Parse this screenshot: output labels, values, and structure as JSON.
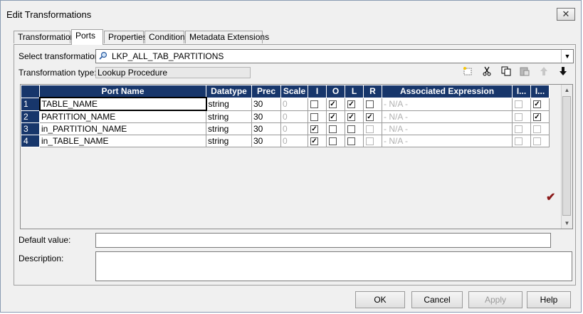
{
  "window": {
    "title": "Edit Transformations",
    "close_glyph": "✕"
  },
  "tabs": [
    {
      "label": "Transformation"
    },
    {
      "label": "Ports"
    },
    {
      "label": "Properties"
    },
    {
      "label": "Condition"
    },
    {
      "label": "Metadata Extensions"
    }
  ],
  "active_tab": "Ports",
  "select_transformation": {
    "label": "Select transformation:",
    "value": "LKP_ALL_TAB_PARTITIONS",
    "icon": "lookup-icon"
  },
  "transformation_type": {
    "label": "Transformation type:",
    "value": "Lookup Procedure"
  },
  "toolbar": {
    "icons": [
      "new-port-icon",
      "cut-icon",
      "copy-icon",
      "paste-icon",
      "move-up-icon",
      "move-down-icon"
    ]
  },
  "ports_table": {
    "columns": [
      "Port Name",
      "Datatype",
      "Prec",
      "Scale",
      "I",
      "O",
      "L",
      "R",
      "Associated Expression",
      "I...",
      "I..."
    ],
    "rows": [
      {
        "num": "1",
        "name": "TABLE_NAME",
        "datatype": "string",
        "prec": "30",
        "scale": "0",
        "I": false,
        "O": true,
        "L": true,
        "R": false,
        "assoc": "- N/A -",
        "c1": false,
        "c2": true
      },
      {
        "num": "2",
        "name": "PARTITION_NAME",
        "datatype": "string",
        "prec": "30",
        "scale": "0",
        "I": false,
        "O": true,
        "L": true,
        "R": true,
        "assoc": "- N/A -",
        "c1": false,
        "c2": true
      },
      {
        "num": "3",
        "name": "in_PARTITION_NAME",
        "datatype": "string",
        "prec": "30",
        "scale": "0",
        "I": true,
        "O": false,
        "L": false,
        "R": false,
        "assoc": "- N/A -",
        "c1": false,
        "c2": false
      },
      {
        "num": "4",
        "name": "in_TABLE_NAME",
        "datatype": "string",
        "prec": "30",
        "scale": "0",
        "I": true,
        "O": false,
        "L": false,
        "R": false,
        "assoc": "- N/A -",
        "c1": false,
        "c2": false
      }
    ]
  },
  "default_value": {
    "label": "Default value:",
    "value": ""
  },
  "description": {
    "label": "Description:",
    "value": ""
  },
  "buttons": {
    "ok": "OK",
    "cancel": "Cancel",
    "apply": "Apply",
    "help": "Help"
  },
  "colors": {
    "header_bg": "#17366b",
    "accent_check": "#8b1a1a"
  }
}
